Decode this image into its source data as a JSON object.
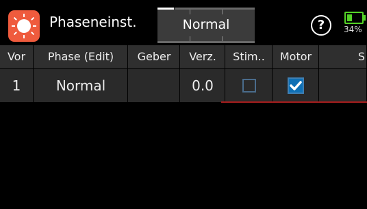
{
  "header": {
    "title": "Phaseneinst.",
    "mode": "Normal",
    "help_icon": "question-circle-icon",
    "battery_percent": "34%",
    "battery_level": 0.34,
    "battery_color": "#54d226",
    "app_icon": "settings-dial-icon",
    "app_icon_color": "#ef5b3d"
  },
  "table": {
    "columns": [
      "Vor",
      "Phase (Edit)",
      "Geber",
      "Verz.",
      "Stim..",
      "Motor",
      "S"
    ],
    "rows": [
      {
        "index": "1",
        "phase": "Normal",
        "geber": "",
        "verz": "0.0",
        "stim_checked": false,
        "motor_checked": true
      }
    ]
  },
  "colors": {
    "accent": "#0f70b5",
    "header_bg": "#2f2f2f",
    "row_bg": "#2a2a2a",
    "underline": "#a81e1e"
  }
}
